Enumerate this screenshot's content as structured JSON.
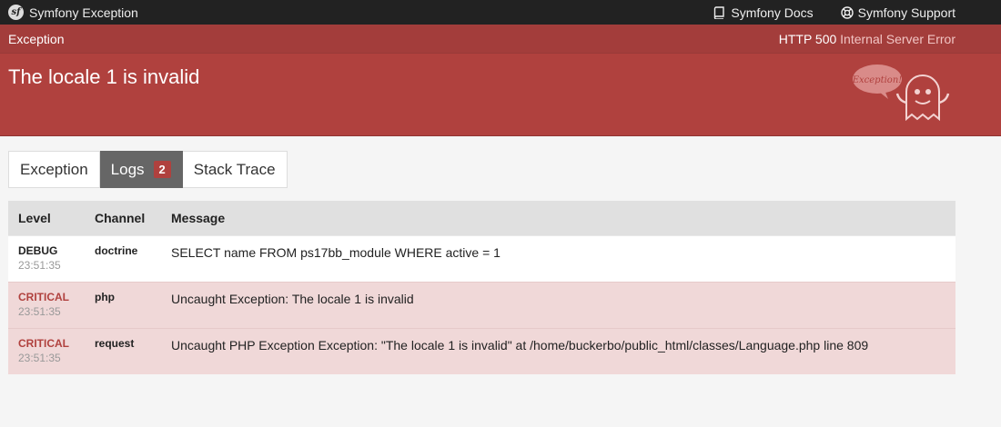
{
  "topbar": {
    "brand": "Symfony Exception",
    "logo_icon": "symfony-logo-icon",
    "links": [
      {
        "label": "Symfony Docs",
        "icon": "book-icon"
      },
      {
        "label": "Symfony Support",
        "icon": "lifebuoy-icon"
      }
    ]
  },
  "summary": {
    "meta_label": "Exception",
    "http_code": "HTTP 500",
    "http_text": "Internal Server Error",
    "title": "The locale 1 is invalid",
    "ghost_text": "Exception!",
    "accent_color": "#b0413e"
  },
  "tabs": [
    {
      "label": "Exception",
      "active": false
    },
    {
      "label": "Logs",
      "active": true,
      "badge": "2"
    },
    {
      "label": "Stack Trace",
      "active": false
    }
  ],
  "logs": {
    "headers": {
      "level": "Level",
      "channel": "Channel",
      "message": "Message"
    },
    "rows": [
      {
        "level": "DEBUG",
        "time": "23:51:35",
        "channel": "doctrine",
        "message": "SELECT name FROM ps17bb_module WHERE active = 1"
      },
      {
        "level": "CRITICAL",
        "time": "23:51:35",
        "channel": "php",
        "message": "Uncaught Exception: The locale 1 is invalid"
      },
      {
        "level": "CRITICAL",
        "time": "23:51:35",
        "channel": "request",
        "message": "Uncaught PHP Exception Exception: \"The locale 1 is invalid\" at /home/buckerbo/public_html/classes/Language.php line 809"
      }
    ]
  }
}
